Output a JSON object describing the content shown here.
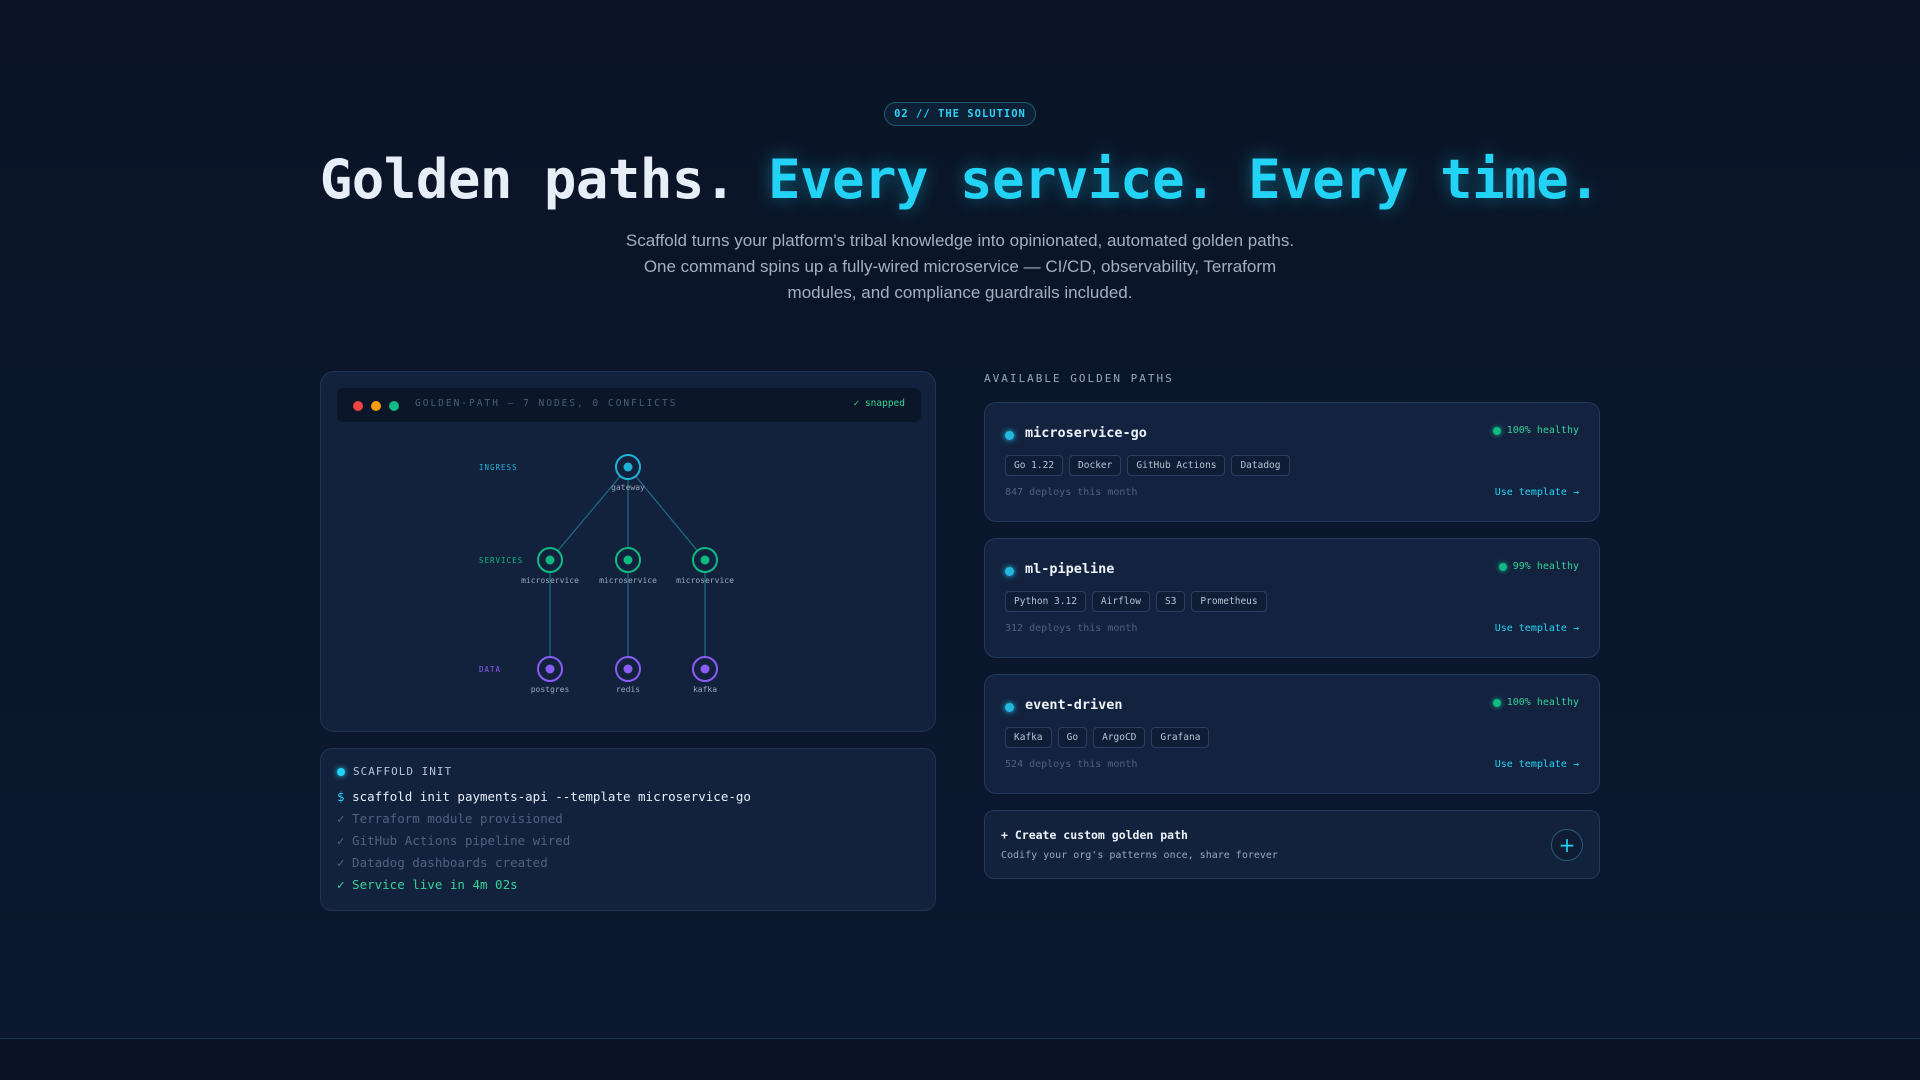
{
  "hero": {
    "badge": "02 // THE SOLUTION",
    "headline_white": "Golden paths.",
    "headline_accent": "Every service. Every time.",
    "subtitle": "Scaffold turns your platform's tribal knowledge into opinionated, automated golden paths. One command spins up a fully-wired microservice — CI/CD, observability, Terraform modules, and compliance guardrails included."
  },
  "graph": {
    "title": "GOLDEN-PATH — 7 NODES, 0 CONFLICTS",
    "status": "✓ snapped",
    "layers": [
      {
        "label": "INGRESS",
        "color": "#1fb2d8"
      },
      {
        "label": "SERVICES",
        "color": "#10b981"
      },
      {
        "label": "DATA",
        "color": "#8b5cf6"
      }
    ],
    "nodes": [
      {
        "id": "gateway",
        "label": "gateway",
        "layer": 0,
        "col": 1
      },
      {
        "id": "svc1",
        "label": "microservice",
        "layer": 1,
        "col": 0
      },
      {
        "id": "svc2",
        "label": "microservice",
        "layer": 1,
        "col": 1
      },
      {
        "id": "svc3",
        "label": "microservice",
        "layer": 1,
        "col": 2
      },
      {
        "id": "pg",
        "label": "postgres",
        "layer": 2,
        "col": 0
      },
      {
        "id": "redis",
        "label": "redis",
        "layer": 2,
        "col": 1
      },
      {
        "id": "kafka",
        "label": "kafka",
        "layer": 2,
        "col": 2
      }
    ],
    "edges": [
      [
        "gateway",
        "svc1"
      ],
      [
        "gateway",
        "svc2"
      ],
      [
        "gateway",
        "svc3"
      ],
      [
        "svc1",
        "pg"
      ],
      [
        "svc2",
        "redis"
      ],
      [
        "svc3",
        "kafka"
      ]
    ]
  },
  "terminal": {
    "title": "SCAFFOLD INIT",
    "prompt": "$",
    "command": "scaffold init payments-api --template microservice-go",
    "steps": [
      {
        "text": "✓ Terraform module provisioned",
        "state": "muted"
      },
      {
        "text": "✓ GitHub Actions pipeline wired",
        "state": "muted"
      },
      {
        "text": "✓ Datadog dashboards created",
        "state": "muted"
      },
      {
        "text": "✓ Service live in 4m 02s",
        "state": "ok"
      }
    ]
  },
  "paths": {
    "section_label": "AVAILABLE GOLDEN PATHS",
    "link_label": "Use template →",
    "items": [
      {
        "name": "microservice-go",
        "health": "100% healthy",
        "tags": [
          "Go 1.22",
          "Docker",
          "GitHub Actions",
          "Datadog"
        ],
        "deploys": "847 deploys this month"
      },
      {
        "name": "ml-pipeline",
        "health": "99% healthy",
        "tags": [
          "Python 3.12",
          "Airflow",
          "S3",
          "Prometheus"
        ],
        "deploys": "312 deploys this month"
      },
      {
        "name": "event-driven",
        "health": "100% healthy",
        "tags": [
          "Kafka",
          "Go",
          "ArgoCD",
          "Grafana"
        ],
        "deploys": "524 deploys this month"
      }
    ]
  },
  "custom": {
    "title": "+ Create custom golden path",
    "subtitle": "Codify your org's patterns once, share forever",
    "button": "+"
  }
}
